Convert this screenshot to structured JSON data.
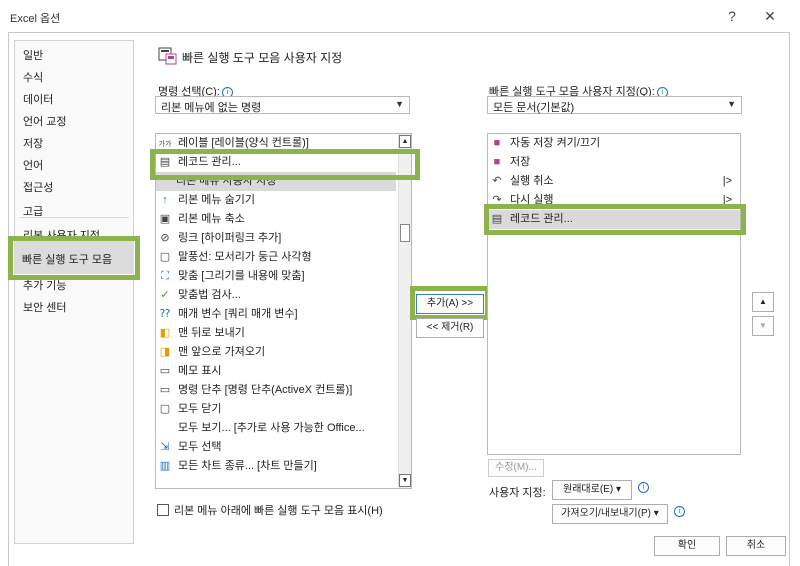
{
  "window": {
    "title": "Excel 옵션",
    "help": "?",
    "close": "✕"
  },
  "nav": {
    "items": [
      "일반",
      "수식",
      "데이터",
      "언어 교정",
      "저장",
      "언어",
      "접근성",
      "고급",
      "리본 사용자 지정",
      "빠른 실행 도구 모음",
      "추가 기능",
      "보안 센터"
    ],
    "selected": "빠른 실행 도구 모음"
  },
  "header": {
    "title": "빠른 실행 도구 모음 사용자 지정"
  },
  "left": {
    "choose_label": "명령 선택(C):",
    "choose_value": "리본 메뉴에 없는 명령",
    "commands": [
      {
        "icon": "가가",
        "label": "레이블 [레이블(양식 컨트롤)]"
      },
      {
        "icon": "▤",
        "label": "레코드 관리..."
      },
      {
        "icon": "",
        "label": "리본 메뉴 사용자 지정"
      },
      {
        "icon": "↑",
        "label": "리본 메뉴 숨기기"
      },
      {
        "icon": "▣",
        "label": "리본 메뉴 축소"
      },
      {
        "icon": "⊘",
        "label": "링크 [하이퍼링크 추가]"
      },
      {
        "icon": "▢",
        "label": "말풍선: 모서리가 둥근 사각형"
      },
      {
        "icon": "⛶",
        "label": "맞춤 [그리기를 내용에 맞춤]"
      },
      {
        "icon": "✓",
        "label": "맞춤법 검사..."
      },
      {
        "icon": "⁇",
        "label": "매개 변수 [쿼리 매개 변수]"
      },
      {
        "icon": "◧",
        "label": "맨 뒤로 보내기"
      },
      {
        "icon": "◨",
        "label": "맨 앞으로 가져오기"
      },
      {
        "icon": "▭",
        "label": "메모 표시"
      },
      {
        "icon": "▭",
        "label": "명령 단추 [명령 단추(ActiveX 컨트롤)]"
      },
      {
        "icon": "▢",
        "label": "모두 닫기"
      },
      {
        "icon": "",
        "label": "모두 보기... [추가로 사용 가능한 Office..."
      },
      {
        "icon": "⇲",
        "label": "모두 선택"
      },
      {
        "icon": "▥",
        "label": "모든 차트 종류... [차트 만들기]"
      }
    ],
    "show_below": "리본 메뉴 아래에 빠른 실행 도구 모음 표시(H)"
  },
  "middle": {
    "add": "추가(A) >>",
    "remove": "<< 제거(R)"
  },
  "right": {
    "customize_label": "빠른 실행 도구 모음 사용자 지정(Q):",
    "customize_value": "모든 문서(기본값)",
    "items": [
      {
        "icon": "💾",
        "label": "자동 저장 켜기/끄기",
        "sub": false
      },
      {
        "icon": "💾",
        "label": "저장",
        "sub": false
      },
      {
        "icon": "↶",
        "label": "실행 취소",
        "sub": true
      },
      {
        "icon": "↷",
        "label": "다시 실행",
        "sub": true
      },
      {
        "icon": "▤",
        "label": "레코드 관리...",
        "sub": false
      }
    ],
    "modify": "수정(M)...",
    "custom_label": "사용자 지정:",
    "reset": "원래대로(E) ▾",
    "import_export": "가져오기/내보내기(P) ▾",
    "sub_arrow": "|>"
  },
  "footer": {
    "ok": "확인",
    "cancel": "취소"
  },
  "colors": {
    "highlight": "#8cb44a",
    "accent": "#1a6fc9",
    "selected": "#dadada"
  }
}
